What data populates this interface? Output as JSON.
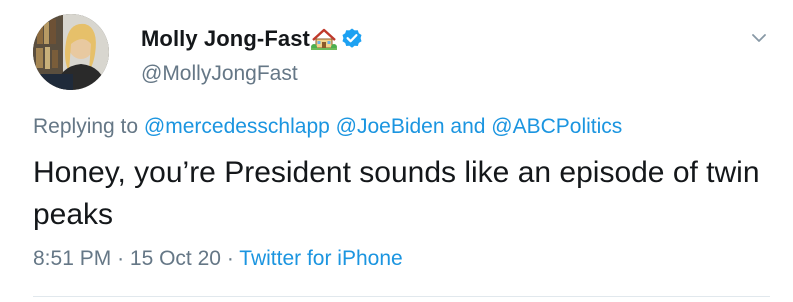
{
  "author": {
    "display_name": "Molly Jong-Fast",
    "emoji_icon": "house-with-garden-icon",
    "verified_icon": "verified-badge-icon",
    "handle": "@MollyJongFast"
  },
  "menu": {
    "icon": "chevron-down-icon"
  },
  "reply": {
    "prefix": "Replying to",
    "mention_1": "@mercedesschlapp",
    "mention_2": "@JoeBiden",
    "conjunction": "and",
    "mention_3": "@ABCPolitics"
  },
  "tweet": {
    "text": "Honey, you’re President sounds like an episode of twin peaks"
  },
  "meta": {
    "time": "8:51 PM",
    "separator_1": "·",
    "date": "15 Oct 20",
    "separator_2": "·",
    "source": "Twitter for iPhone"
  },
  "colors": {
    "link": "#1b95e0",
    "secondary_text": "#657786",
    "primary_text": "#14171a",
    "verified": "#1da1f2"
  }
}
